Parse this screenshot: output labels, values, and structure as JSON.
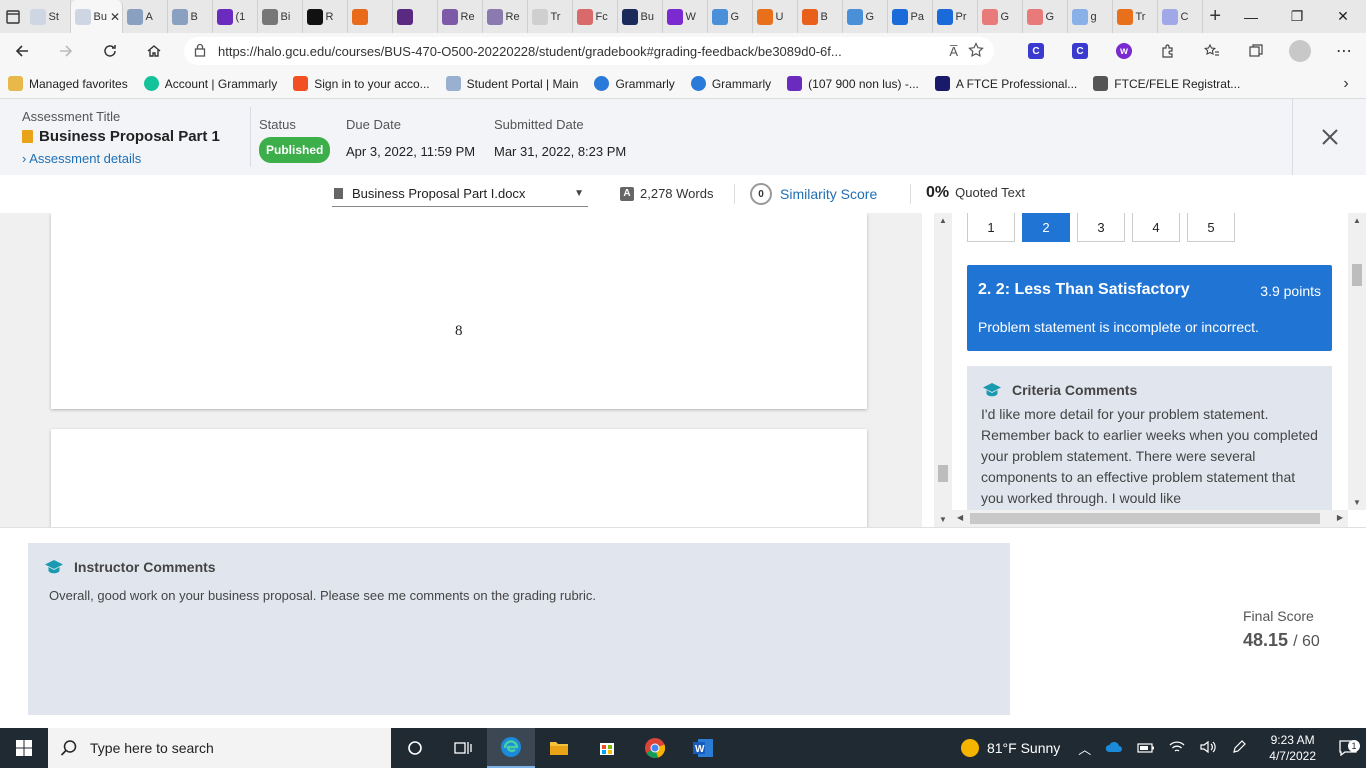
{
  "browser": {
    "tabs": [
      {
        "label": "St",
        "color": "#cdd6e2"
      },
      {
        "label": "Bu",
        "color": "#cdd6e2",
        "active": true
      },
      {
        "label": "A",
        "color": "#8aa0c0"
      },
      {
        "label": "B",
        "color": "#8aa0c0"
      },
      {
        "label": "(1",
        "color": "#6b2bbf"
      },
      {
        "label": "Bi",
        "color": "#777777"
      },
      {
        "label": "R",
        "color": "#111111"
      },
      {
        "label": "",
        "color": "#e86a1a"
      },
      {
        "label": "",
        "color": "#5a2a82"
      },
      {
        "label": "Re",
        "color": "#7c5aa8"
      },
      {
        "label": "Re",
        "color": "#8a7ab0"
      },
      {
        "label": "Tr",
        "color": "#cfcfcf"
      },
      {
        "label": "Fc",
        "color": "#d96a6a"
      },
      {
        "label": "Bu",
        "color": "#1a2a5a"
      },
      {
        "label": "W",
        "color": "#7a2ad0"
      },
      {
        "label": "G",
        "color": "#4a90d9"
      },
      {
        "label": "U",
        "color": "#e8701a"
      },
      {
        "label": "B",
        "color": "#e8601a"
      },
      {
        "label": "G",
        "color": "#4a90d9"
      },
      {
        "label": "Pa",
        "color": "#1a6ad9"
      },
      {
        "label": "Pr",
        "color": "#1a6ad9"
      },
      {
        "label": "G",
        "color": "#e87a7a"
      },
      {
        "label": "G",
        "color": "#e87a7a"
      },
      {
        "label": "g",
        "color": "#8ab0e8"
      },
      {
        "label": "Tr",
        "color": "#e8701a"
      },
      {
        "label": "C",
        "color": "#a0a8e8"
      }
    ],
    "active_tab_close": "✕",
    "new_tab": "+",
    "window_controls": {
      "minimize": "—",
      "restore": "❐",
      "close": "✕"
    },
    "url": "https://halo.gcu.edu/courses/BUS-470-O500-20220228/student/gradebook#grading-feedback/be3089d0-6f...",
    "read_aloud": "A̅",
    "favorites": [
      {
        "label": "Managed favorites",
        "icon": "folder-icon",
        "color": "#e8b84a"
      },
      {
        "label": "Account | Grammarly",
        "icon": "grammarly-icon",
        "color": "#15c39a"
      },
      {
        "label": "Sign in to your acco...",
        "icon": "microsoft-icon",
        "color": "#f25022"
      },
      {
        "label": "Student Portal | Main",
        "icon": "page-icon",
        "color": "#9ab0d0"
      },
      {
        "label": "Grammarly",
        "icon": "grammarly-icon",
        "color": "#2a7ad9"
      },
      {
        "label": "Grammarly",
        "icon": "grammarly-icon",
        "color": "#2a7ad9"
      },
      {
        "label": "(107 900 non lus) -...",
        "icon": "mail-icon",
        "color": "#6b2bbf"
      },
      {
        "label": "A FTCE Professional...",
        "icon": "p-icon",
        "color": "#1a1a6a"
      },
      {
        "label": "FTCE/FELE Registrat...",
        "icon": "document-icon",
        "color": "#555555"
      }
    ]
  },
  "assessment": {
    "title_label": "Assessment Title",
    "title": "Business Proposal Part 1",
    "details_link": "Assessment details",
    "status_label": "Status",
    "status": "Published",
    "due_label": "Due Date",
    "due": "Apr 3, 2022, 11:59 PM",
    "submitted_label": "Submitted Date",
    "submitted": "Mar 31, 2022, 8:23 PM",
    "status_color": "#3cae4a"
  },
  "doc_toolbar": {
    "file": "Business Proposal Part I.docx",
    "word_count": "2,278 Words",
    "similarity_value": "0",
    "similarity_label": "Similarity Score",
    "quoted_percent": "0%",
    "quoted_label": "Quoted Text"
  },
  "document": {
    "page_number": "8"
  },
  "rubric": {
    "levels": [
      "1",
      "2",
      "3",
      "4",
      "5"
    ],
    "selected_level": "2",
    "level_title": "2. 2: Less Than Satisfactory",
    "level_points": "3.9 points",
    "level_desc": "Problem statement is incomplete or incorrect.",
    "criteria_title": "Criteria Comments",
    "criteria_text": "I'd like more detail for your problem statement. Remember back to earlier weeks when you completed your problem statement. There were several components to an effective problem statement that you worked through. I would like",
    "accent": "#1f74d4"
  },
  "instructor": {
    "title": "Instructor Comments",
    "text": "Overall, good work on your business proposal. Please see me comments on the grading rubric."
  },
  "final_score": {
    "label": "Final Score",
    "score": "48.15",
    "total": "/ 60"
  },
  "taskbar": {
    "search_placeholder": "Type here to search",
    "weather": "81°F  Sunny",
    "time": "9:23 AM",
    "date": "4/7/2022",
    "notifications": "1"
  }
}
